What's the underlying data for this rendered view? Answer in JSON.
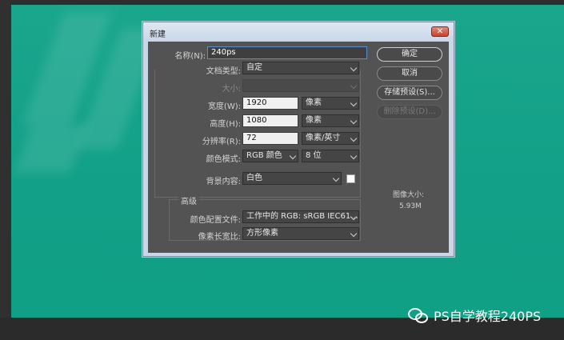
{
  "dialog": {
    "title": "新建",
    "close_icon": "close-icon",
    "name": {
      "label": "名称(N):",
      "value": "240ps"
    },
    "doc_type": {
      "label": "文档类型:",
      "value": "自定"
    },
    "size": {
      "label": "大小:",
      "value": ""
    },
    "width": {
      "label": "宽度(W):",
      "value": "1920",
      "unit": "像素"
    },
    "height": {
      "label": "高度(H):",
      "value": "1080",
      "unit": "像素"
    },
    "resolution": {
      "label": "分辨率(R):",
      "value": "72",
      "unit": "像素/英寸"
    },
    "color_mode": {
      "label": "颜色模式:",
      "value": "RGB 颜色",
      "depth": "8 位"
    },
    "background": {
      "label": "背景内容:",
      "value": "白色",
      "swatch_color": "#ffffff"
    },
    "advanced": {
      "title": "高级",
      "color_profile": {
        "label": "颜色配置文件:",
        "value": "工作中的 RGB: sRGB IEC61..."
      },
      "pixel_aspect": {
        "label": "像素长宽比:",
        "value": "方形像素"
      }
    },
    "buttons": {
      "ok": "确定",
      "cancel": "取消",
      "save_preset": "存储预设(S)...",
      "delete_preset": "删除预设(D)..."
    },
    "image_size": {
      "label": "图像大小:",
      "value": "5.93M"
    }
  },
  "watermark": {
    "text": "PS自学教程240PS",
    "icon": "wechat-icon"
  },
  "colors": {
    "canvas": "#12a088",
    "dialog_body": "#535353",
    "title_bar": "#c8d6e8",
    "close": "#c8432c"
  }
}
